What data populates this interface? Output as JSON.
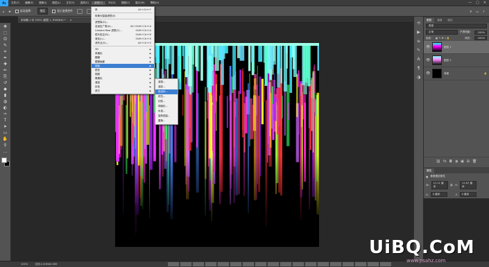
{
  "app": {
    "logo": "Ps"
  },
  "menubar": {
    "items": [
      "文件(F)",
      "编辑(E)",
      "图像(I)",
      "图层(L)",
      "文字(Y)",
      "选择(S)",
      "滤镜(T)",
      "3D(D)",
      "视图(V)",
      "窗口(W)",
      "帮助(H)"
    ],
    "active_index": 6,
    "window_buttons": [
      "—",
      "▢",
      "✕"
    ]
  },
  "options_bar": {
    "auto_select_label": "自动选择：",
    "auto_select_target": "图层",
    "transform_controls_label": "显示变换控件",
    "mode_label": "3D 模式："
  },
  "document": {
    "tab_title": "未标题-1 @ 100% (图层 1, RGB/8#) *",
    "tab_close": "×"
  },
  "toolbar": {
    "tools": [
      "move-tool",
      "marquee-tool",
      "lasso-tool",
      "quick-select-tool",
      "crop-tool",
      "eyedropper-tool",
      "healing-tool",
      "brush-tool",
      "stamp-tool",
      "history-brush-tool",
      "eraser-tool",
      "gradient-tool",
      "blur-tool",
      "dodge-tool",
      "pen-tool",
      "type-tool",
      "path-select-tool",
      "shape-tool",
      "hand-tool",
      "zoom-tool",
      "more-tool"
    ],
    "tool_glyphs": [
      "✥",
      "⬚",
      "ʘ",
      "✎",
      "⌗",
      "✒",
      "✚",
      "✏",
      "⎘",
      "↺",
      "◆",
      "▮",
      "◍",
      "◐",
      "✑",
      "T",
      "➤",
      "▭",
      "✋",
      "⚲",
      "…"
    ],
    "foreground_color": "#ffffff",
    "background_color": "#000000"
  },
  "filter_menu": {
    "items": [
      {
        "label": "风",
        "shortcut": "Alt+Ctrl+F"
      },
      {
        "sep": true
      },
      {
        "label": "转换为智能滤镜(S)",
        "shortcut": ""
      },
      {
        "sep": true
      },
      {
        "label": "滤镜库(G)...",
        "shortcut": ""
      },
      {
        "label": "自适应广角(A)...",
        "shortcut": "Alt+Shift+Ctrl+A"
      },
      {
        "label": "Camera Raw 滤镜(C)...",
        "shortcut": "Shift+Ctrl+A"
      },
      {
        "label": "镜头校正(R)...",
        "shortcut": "Shift+Ctrl+R"
      },
      {
        "label": "液化(L)...",
        "shortcut": "Shift+Ctrl+X"
      },
      {
        "label": "消失点(V)...",
        "shortcut": "Alt+Ctrl+V"
      },
      {
        "sep": true
      },
      {
        "label": "3D",
        "submenu": true
      },
      {
        "label": "风格化",
        "submenu": true
      },
      {
        "label": "模糊",
        "submenu": true
      },
      {
        "label": "模糊画廊",
        "submenu": true
      },
      {
        "label": "扭曲",
        "submenu": true,
        "highlight": true
      },
      {
        "label": "锐化",
        "submenu": true
      },
      {
        "label": "视频",
        "submenu": true
      },
      {
        "label": "像素化",
        "submenu": true
      },
      {
        "label": "渲染",
        "submenu": true
      },
      {
        "label": "杂色",
        "submenu": true
      },
      {
        "label": "其它",
        "submenu": true
      }
    ]
  },
  "distort_submenu": {
    "items": [
      {
        "label": "波浪..."
      },
      {
        "label": "波纹..."
      },
      {
        "label": "极坐标...",
        "highlight": true
      },
      {
        "label": "挤压..."
      },
      {
        "label": "切变..."
      },
      {
        "label": "球面化..."
      },
      {
        "label": "水波..."
      },
      {
        "label": "旋转扭曲..."
      },
      {
        "label": "置换..."
      }
    ]
  },
  "right_icon_column": {
    "icons": [
      "history-icon",
      "actions-icon",
      "properties-icon",
      "brush-icon",
      "character-icon",
      "paragraph-icon",
      "adjust-icon"
    ],
    "glyphs": [
      "⟲",
      "▶",
      "≡",
      "✎",
      "A",
      "¶",
      "◑"
    ]
  },
  "layers_panel": {
    "tabs": [
      "图层",
      "通道",
      "路径"
    ],
    "active_tab": 0,
    "kind_label": "类型",
    "blend_mode": "正常",
    "opacity_label": "不透明度：",
    "opacity_value": "100%",
    "lock_label": "锁定：",
    "fill_label": "填充：",
    "fill_value": "100%",
    "layers": [
      {
        "name": "图层 1",
        "selected": true,
        "visible": true
      },
      {
        "name": "图层 2",
        "selected": false,
        "visible": true
      },
      {
        "name": "背景",
        "selected": false,
        "visible": true,
        "locked": true
      }
    ],
    "footer_icons": [
      "link-icon",
      "fx-icon",
      "mask-icon",
      "adjustment-icon",
      "group-icon",
      "new-layer-icon",
      "delete-icon"
    ],
    "footer_glyphs": [
      "⛓",
      "fx",
      "◘",
      "◑",
      "▣",
      "⊞",
      "🗑"
    ]
  },
  "properties_panel": {
    "title": "属性",
    "subtitle": "像素图层属性",
    "w_label": "W:",
    "w_value": "11.11 厘米",
    "h_label": "H:",
    "h_value": "11.67 厘米",
    "x_label": "X:",
    "x_value": "0 厘米",
    "y_label": "Y:",
    "y_value": "0 厘米"
  },
  "status_bar": {
    "zoom": "100%",
    "doc_info": "文档:2.00M/8.03M"
  },
  "watermark": {
    "main": "UiBQ.CoM",
    "sub": "www.psahz.com"
  }
}
